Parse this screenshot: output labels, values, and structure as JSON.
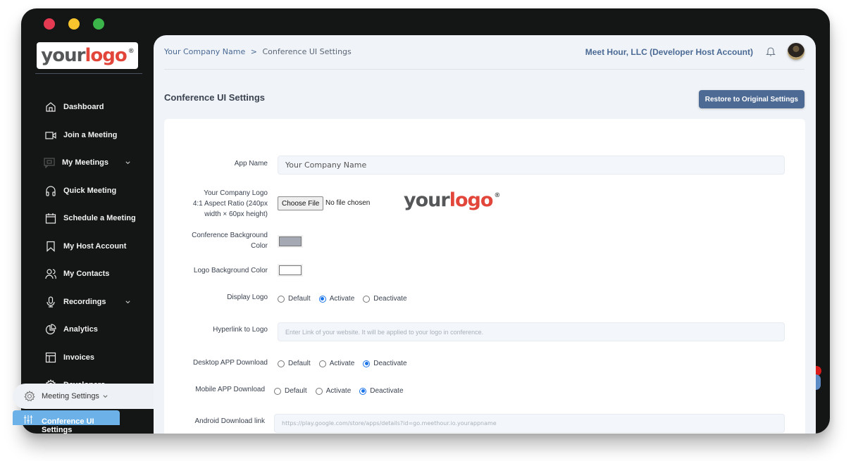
{
  "window": {
    "traffic_lights": [
      {
        "name": "close",
        "color": "#e53b52"
      },
      {
        "name": "minimize",
        "color": "#f7c42e"
      },
      {
        "name": "maximize",
        "color": "#3bb54a"
      }
    ]
  },
  "brand": {
    "logo_part1": "your",
    "logo_part2": "logo",
    "logo_mark": "®"
  },
  "sidebar": {
    "items": [
      {
        "label": "Dashboard",
        "icon": "home-icon",
        "has_chevron": false
      },
      {
        "label": "Join a Meeting",
        "icon": "video-camera-icon",
        "has_chevron": false
      },
      {
        "label": "My Meetings",
        "icon": "chat-icon",
        "has_chevron": true
      },
      {
        "label": "Quick Meeting",
        "icon": "headphones-icon",
        "has_chevron": false
      },
      {
        "label": "Schedule a Meeting",
        "icon": "calendar-icon",
        "has_chevron": false
      },
      {
        "label": "My Host Account",
        "icon": "bookmark-icon",
        "has_chevron": false
      },
      {
        "label": "My Contacts",
        "icon": "users-icon",
        "has_chevron": false
      },
      {
        "label": "Recordings",
        "icon": "microphone-icon",
        "has_chevron": true
      },
      {
        "label": "Analytics",
        "icon": "pie-chart-icon",
        "has_chevron": false
      },
      {
        "label": "Invoices",
        "icon": "layout-icon",
        "has_chevron": false
      },
      {
        "label": "Developers",
        "icon": "gear-icon",
        "has_chevron": true
      }
    ],
    "meeting_settings": {
      "label": "Meeting Settings",
      "icon": "gear-icon",
      "expanded": true
    },
    "conference_ui": {
      "label": "Conference UI Settings",
      "icon": "sliders-icon",
      "active": true
    }
  },
  "header": {
    "breadcrumb": {
      "root": "Your Company Name",
      "separator": ">",
      "current": "Conference UI Settings"
    },
    "account": "Meet Hour, LLC (Developer Host Account)"
  },
  "page": {
    "title": "Conference UI Settings",
    "restore_button": "Restore to Original Settings"
  },
  "form": {
    "app_name": {
      "label": "App Name",
      "value": "Your Company Name"
    },
    "company_logo": {
      "label_lines": [
        "Your Company Logo",
        "4:1 Aspect Ratio (240px",
        "width × 60px height)"
      ],
      "button": "Choose File",
      "status": "No file chosen"
    },
    "conference_bg": {
      "label_lines": [
        "Conference Background",
        "Color"
      ],
      "value": "#a4a9b3"
    },
    "logo_bg": {
      "label": "Logo Background Color",
      "value": "#ffffff"
    },
    "display_logo": {
      "label": "Display Logo",
      "options": [
        "Default",
        "Activate",
        "Deactivate"
      ],
      "selected": "Activate"
    },
    "hyperlink": {
      "label": "Hyperlink to Logo",
      "placeholder": "Enter Link of your website. It will be applied to your logo in conference."
    },
    "desktop_download": {
      "label": "Desktop APP Download",
      "options": [
        "Default",
        "Activate",
        "Deactivate"
      ],
      "selected": "Deactivate"
    },
    "mobile_download": {
      "label": "Mobile APP Download",
      "options": [
        "Default",
        "Activate",
        "Deactivate"
      ],
      "selected": "Deactivate"
    },
    "android_link": {
      "label": "Android Download link",
      "placeholder": "https://play.google.com/store/apps/details?id=go.meethour.io.yourappname"
    }
  }
}
